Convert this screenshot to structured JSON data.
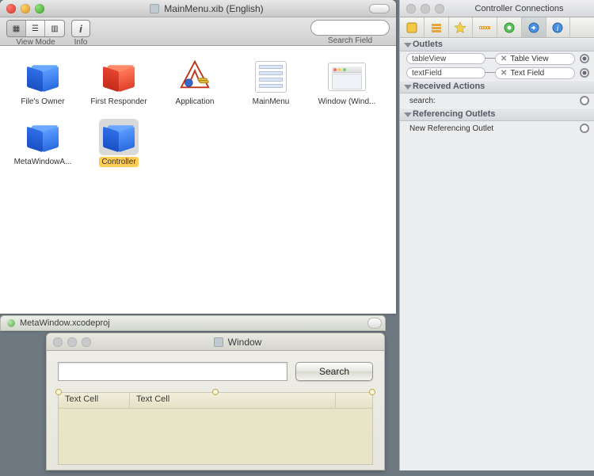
{
  "xib": {
    "title": "MainMenu.xib (English)",
    "toolbar": {
      "view_mode_label": "View Mode",
      "info_label": "Info",
      "search_label": "Search Field",
      "search_placeholder": ""
    },
    "objects": [
      {
        "label": "File's Owner",
        "icon": "cube-blue"
      },
      {
        "label": "First Responder",
        "icon": "cube-red"
      },
      {
        "label": "Application",
        "icon": "app"
      },
      {
        "label": "MainMenu",
        "icon": "menu"
      },
      {
        "label": "Window (Wind...",
        "icon": "window"
      },
      {
        "label": "MetaWindowA...",
        "icon": "cube-blue"
      },
      {
        "label": "Controller",
        "icon": "cube-blue",
        "selected": true
      }
    ]
  },
  "project": {
    "title": "MetaWindow.xcodeproj"
  },
  "win2": {
    "title": "Window",
    "search_button": "Search",
    "columns": [
      "Text Cell",
      "Text Cell"
    ]
  },
  "inspector": {
    "title": "Controller Connections",
    "sections": {
      "outlets": {
        "title": "Outlets",
        "rows": [
          {
            "name": "tableView",
            "dest": "Table View"
          },
          {
            "name": "textField",
            "dest": "Text Field"
          }
        ]
      },
      "received": {
        "title": "Received Actions",
        "rows": [
          {
            "name": "search:"
          }
        ]
      },
      "referencing": {
        "title": "Referencing Outlets",
        "rows": [
          {
            "name": "New Referencing Outlet"
          }
        ]
      }
    }
  }
}
